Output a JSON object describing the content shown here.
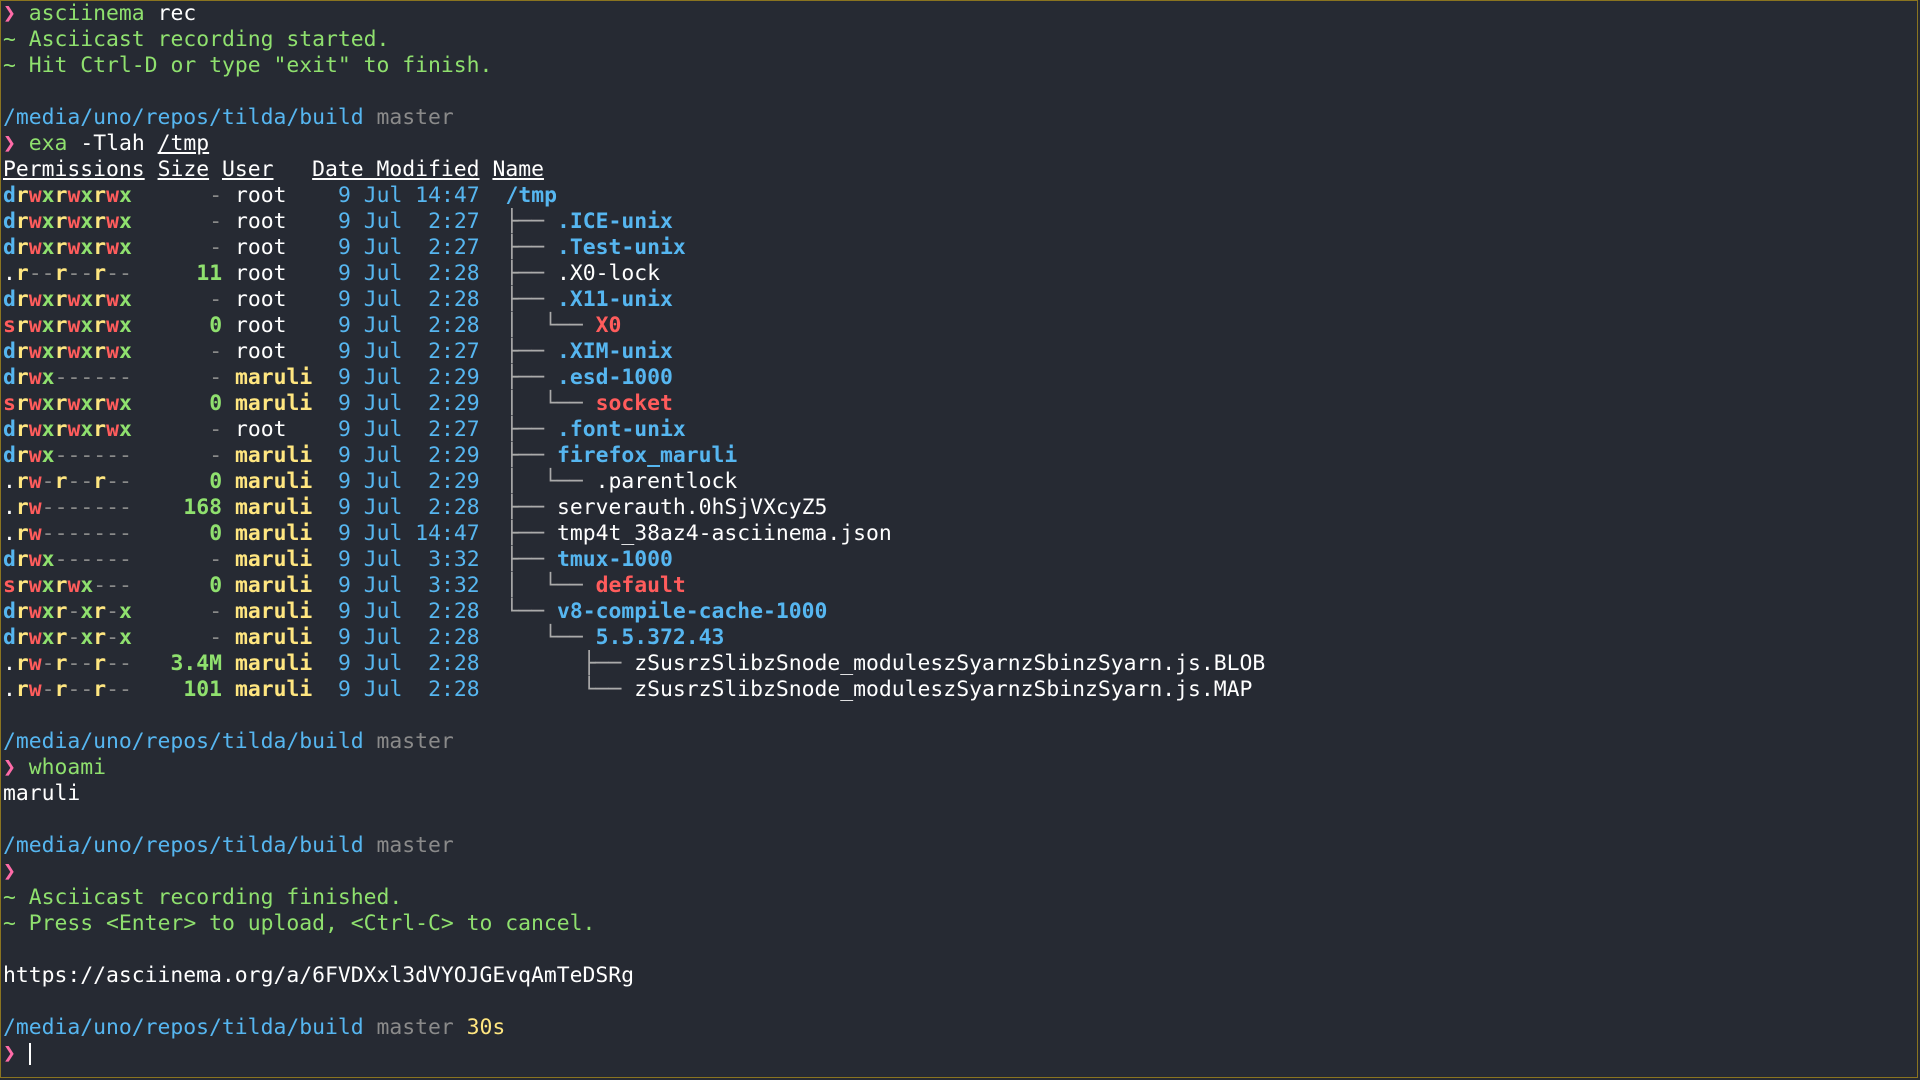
{
  "prompt_char": "❯",
  "tilde": "~",
  "rec": {
    "cmd_prog": "asciinema",
    "cmd_arg": "rec",
    "started": "Asciicast recording started.",
    "hint": "Hit Ctrl-D or type \"exit\" to finish."
  },
  "path": "/media/uno/repos/tilda/build",
  "branch": "master",
  "exa": {
    "prog": "exa",
    "flags": "-Tlah",
    "target": "/tmp",
    "headers": {
      "perm": "Permissions",
      "size": "Size",
      "user": "User",
      "date": "Date Modified",
      "name": "Name"
    },
    "rows": [
      {
        "type": "d",
        "perm": "rwxrwxrwx",
        "size": "-",
        "user": "root",
        "date": "9 Jul 14:47",
        "tree": "",
        "name": "/tmp",
        "kind": "dir"
      },
      {
        "type": "d",
        "perm": "rwxrwxrwx",
        "size": "-",
        "user": "root",
        "date": "9 Jul  2:27",
        "tree": "├── ",
        "name": ".ICE-unix",
        "kind": "dir"
      },
      {
        "type": "d",
        "perm": "rwxrwxrwx",
        "size": "-",
        "user": "root",
        "date": "9 Jul  2:27",
        "tree": "├── ",
        "name": ".Test-unix",
        "kind": "dir"
      },
      {
        "type": ".",
        "perm": "r--r--r--",
        "size": "11",
        "user": "root",
        "date": "9 Jul  2:28",
        "tree": "├── ",
        "name": ".X0-lock",
        "kind": "file"
      },
      {
        "type": "d",
        "perm": "rwxrwxrwx",
        "size": "-",
        "user": "root",
        "date": "9 Jul  2:28",
        "tree": "├── ",
        "name": ".X11-unix",
        "kind": "dir"
      },
      {
        "type": "s",
        "perm": "rwxrwxrwx",
        "size": "0",
        "user": "root",
        "date": "9 Jul  2:28",
        "tree": "│  └── ",
        "name": "X0",
        "kind": "socket"
      },
      {
        "type": "d",
        "perm": "rwxrwxrwx",
        "size": "-",
        "user": "root",
        "date": "9 Jul  2:27",
        "tree": "├── ",
        "name": ".XIM-unix",
        "kind": "dir"
      },
      {
        "type": "d",
        "perm": "rwx------",
        "size": "-",
        "user": "maruli",
        "date": "9 Jul  2:29",
        "tree": "├── ",
        "name": ".esd-1000",
        "kind": "dir"
      },
      {
        "type": "s",
        "perm": "rwxrwxrwx",
        "size": "0",
        "user": "maruli",
        "date": "9 Jul  2:29",
        "tree": "│  └── ",
        "name": "socket",
        "kind": "socket"
      },
      {
        "type": "d",
        "perm": "rwxrwxrwx",
        "size": "-",
        "user": "root",
        "date": "9 Jul  2:27",
        "tree": "├── ",
        "name": ".font-unix",
        "kind": "dir"
      },
      {
        "type": "d",
        "perm": "rwx------",
        "size": "-",
        "user": "maruli",
        "date": "9 Jul  2:29",
        "tree": "├── ",
        "name": "firefox_maruli",
        "kind": "dir"
      },
      {
        "type": ".",
        "perm": "rw-r--r--",
        "size": "0",
        "user": "maruli",
        "date": "9 Jul  2:29",
        "tree": "│  └── ",
        "name": ".parentlock",
        "kind": "file"
      },
      {
        "type": ".",
        "perm": "rw-------",
        "size": "168",
        "user": "maruli",
        "date": "9 Jul  2:28",
        "tree": "├── ",
        "name": "serverauth.0hSjVXcyZ5",
        "kind": "file"
      },
      {
        "type": ".",
        "perm": "rw-------",
        "size": "0",
        "user": "maruli",
        "date": "9 Jul 14:47",
        "tree": "├── ",
        "name": "tmp4t_38az4-asciinema.json",
        "kind": "file"
      },
      {
        "type": "d",
        "perm": "rwx------",
        "size": "-",
        "user": "maruli",
        "date": "9 Jul  3:32",
        "tree": "├── ",
        "name": "tmux-1000",
        "kind": "dir"
      },
      {
        "type": "s",
        "perm": "rwxrwx---",
        "size": "0",
        "user": "maruli",
        "date": "9 Jul  3:32",
        "tree": "│  └── ",
        "name": "default",
        "kind": "socket"
      },
      {
        "type": "d",
        "perm": "rwxr-xr-x",
        "size": "-",
        "user": "maruli",
        "date": "9 Jul  2:28",
        "tree": "└── ",
        "name": "v8-compile-cache-1000",
        "kind": "dir"
      },
      {
        "type": "d",
        "perm": "rwxr-xr-x",
        "size": "-",
        "user": "maruli",
        "date": "9 Jul  2:28",
        "tree": "   └── ",
        "name": "5.5.372.43",
        "kind": "dir"
      },
      {
        "type": ".",
        "perm": "rw-r--r--",
        "size": "3.4M",
        "user": "maruli",
        "date": "9 Jul  2:28",
        "tree": "      ├── ",
        "name": "zSusrzSlibzSnode_moduleszSyarnzSbinzSyarn.js.BLOB",
        "kind": "file"
      },
      {
        "type": ".",
        "perm": "rw-r--r--",
        "size": "101",
        "user": "maruli",
        "date": "9 Jul  2:28",
        "tree": "      └── ",
        "name": "zSusrzSlibzSnode_moduleszSyarnzSbinzSyarn.js.MAP",
        "kind": "file"
      }
    ]
  },
  "whoami": {
    "cmd": "whoami",
    "output": "maruli"
  },
  "finish": {
    "finished": "Asciicast recording finished.",
    "press": "Press <Enter> to upload, <Ctrl-C> to cancel.",
    "url": "https://asciinema.org/a/6FVDXxl3dVYOJGEvqAmTeDSRg"
  },
  "duration": "30s",
  "colors": {
    "background": "#262a33",
    "border": "#8a7420",
    "green": "#8fe06e",
    "pink": "#ff6ba8",
    "blue": "#56b6f0",
    "gray": "#8a8a8a",
    "yellow": "#ffe680",
    "red": "#ff5c5c"
  }
}
